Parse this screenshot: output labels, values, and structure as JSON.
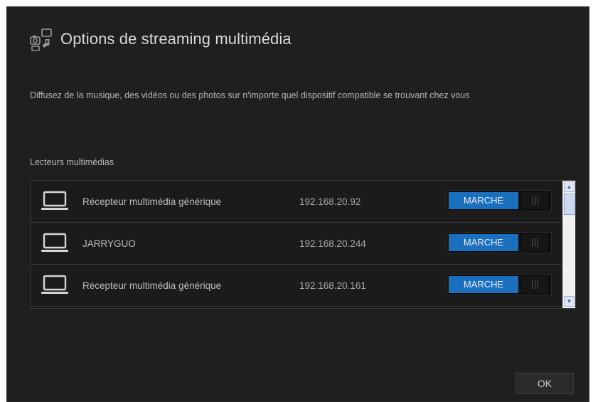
{
  "dialog": {
    "title": "Options de streaming multimédia",
    "description": "Diffusez de la musique, des vidéos ou des photos sur n'importe quel dispositif compatible se trouvant chez vous",
    "section_label": "Lecteurs multimédias",
    "ok_label": "OK"
  },
  "players": [
    {
      "name": "Récepteur multimédia générique",
      "ip": "192.168.20.92",
      "toggle_label": "MARCHE",
      "icon": "laptop-icon"
    },
    {
      "name": "JARRYGUO",
      "ip": "192.168.20.244",
      "toggle_label": "MARCHE",
      "icon": "laptop-icon"
    },
    {
      "name": "Récepteur multimédia générique",
      "ip": "192.168.20.161",
      "toggle_label": "MARCHE",
      "icon": "laptop-icon"
    }
  ],
  "colors": {
    "background": "#1f1f1f",
    "toggle_on": "#1a6fbf",
    "text": "#bdbdbd"
  }
}
